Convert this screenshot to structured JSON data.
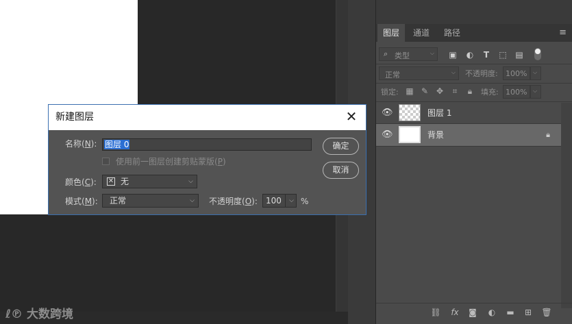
{
  "watermark": {
    "logo": "ℓ℗",
    "text": "大数跨境"
  },
  "panel": {
    "tabs": [
      {
        "label": "图层",
        "active": true
      },
      {
        "label": "通道",
        "active": false
      },
      {
        "label": "路径",
        "active": false
      }
    ],
    "menu_icon": "hamburger-menu-icon",
    "filter_kind": "类型",
    "blend_mode": "正常",
    "opacity_label": "不透明度:",
    "opacity_value": "100%",
    "lock_label": "锁定:",
    "fill_label": "填充:",
    "fill_value": "100%",
    "layers": [
      {
        "name": "图层 1",
        "visible": true,
        "thumb": "transparent",
        "locked": false,
        "selected": false
      },
      {
        "name": "背景",
        "visible": true,
        "thumb": "white",
        "locked": true,
        "selected": true
      }
    ],
    "bottom_icons": [
      "link-icon",
      "fx-icon",
      "mask-icon",
      "adjustment-icon",
      "folder-icon",
      "new-layer-icon",
      "trash-icon"
    ]
  },
  "dialog": {
    "title": "新建图层",
    "name_label": "名称(",
    "name_key": "N",
    "name_suffix": "):",
    "name_value": "图层 0",
    "clip_label": "使用前一图层创建剪贴蒙版(",
    "clip_key": "P",
    "clip_suffix": ")",
    "clip_checked": false,
    "color_label": "颜色(",
    "color_key": "C",
    "color_suffix": "):",
    "color_value": "无",
    "mode_label": "模式(",
    "mode_key": "M",
    "mode_suffix": "):",
    "mode_value": "正常",
    "opacity_label": "不透明度(",
    "opacity_key": "O",
    "opacity_suffix": "):",
    "opacity_value": "100",
    "opacity_unit": "%",
    "ok_label": "确定",
    "cancel_label": "取消"
  },
  "colors": {
    "selection": "#2b6fd3",
    "dialog_border": "#3a6fb0",
    "selected_layer": "#686868"
  }
}
